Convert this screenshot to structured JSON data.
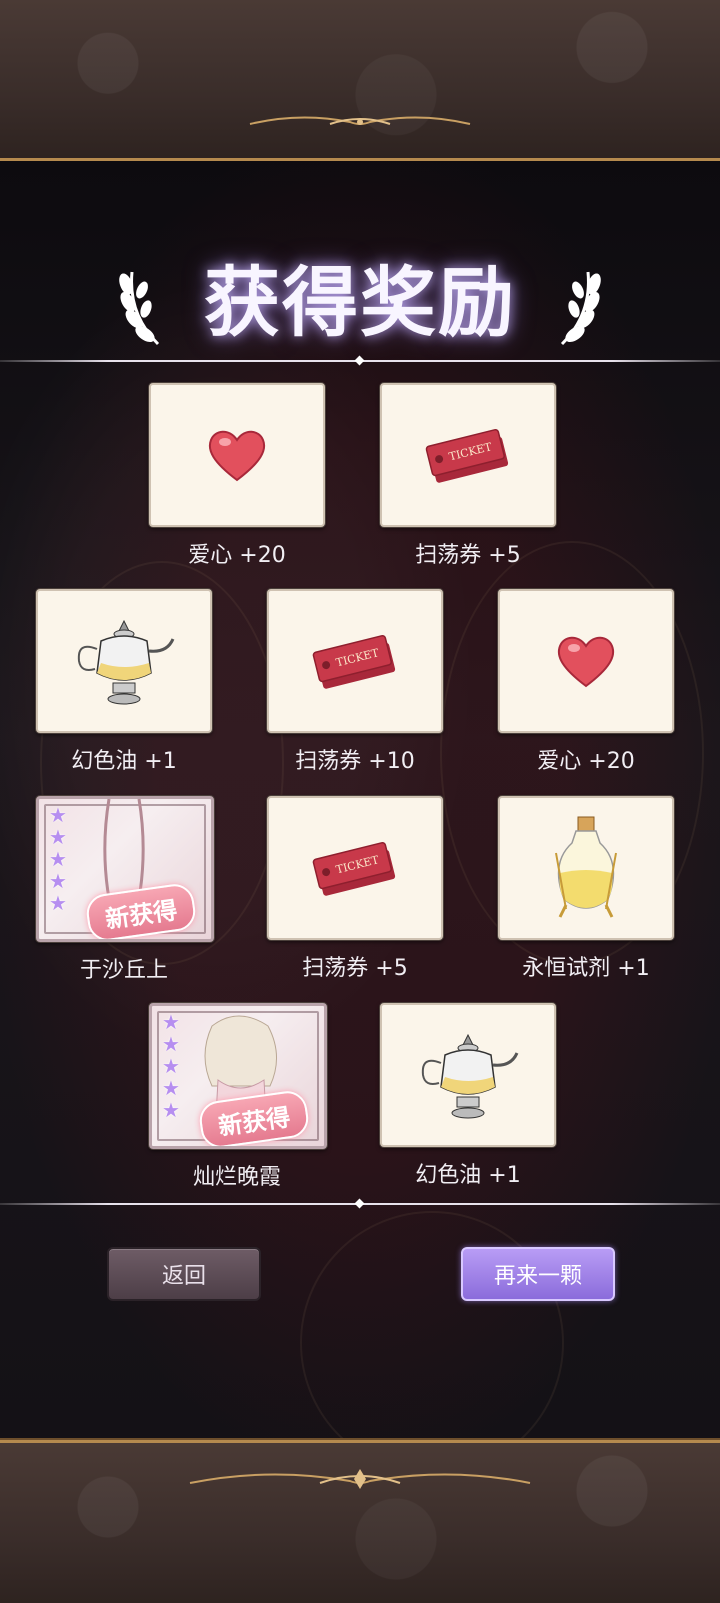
{
  "title": "获得奖励",
  "rewards": [
    {
      "label": "爱心 +20",
      "icon": "heart-icon"
    },
    {
      "label": "扫荡券 +5",
      "icon": "ticket-icon"
    },
    {
      "label": "幻色油 +1",
      "icon": "teapot-icon"
    },
    {
      "label": "扫荡券 +10",
      "icon": "ticket-icon"
    },
    {
      "label": "爱心 +20",
      "icon": "heart-icon"
    },
    {
      "label": "于沙丘上",
      "icon": "card-art",
      "stars": 5,
      "badge": "新获得"
    },
    {
      "label": "扫荡券 +5",
      "icon": "ticket-icon"
    },
    {
      "label": "永恒试剂 +1",
      "icon": "potion-bottle-icon"
    },
    {
      "label": "灿烂晚霞",
      "icon": "card-art",
      "stars": 5,
      "badge": "新获得"
    },
    {
      "label": "幻色油 +1",
      "icon": "teapot-icon"
    }
  ],
  "ticket_text": "TICKET",
  "buttons": {
    "back": "返回",
    "again": "再来一颗"
  },
  "colors": {
    "accent_purple": "#9b7ce6",
    "gold_border": "#b58a4e",
    "card_bg": "#fbf5ea"
  }
}
